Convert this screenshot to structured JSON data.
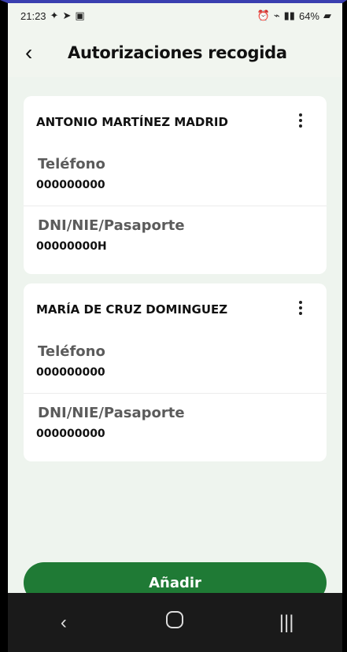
{
  "status_bar": {
    "time": "21:23",
    "battery": "64%"
  },
  "app_bar": {
    "back_icon": "‹",
    "title": "Autorizaciones recogida"
  },
  "authorizations": [
    {
      "name": "ANTONIO MARTÍNEZ MADRID",
      "phone_label": "Teléfono",
      "phone_value": "000000000",
      "id_label": "DNI/NIE/Pasaporte",
      "id_value": "00000000H"
    },
    {
      "name": "MARÍA DE CRUZ DOMINGUEZ",
      "phone_label": "Teléfono",
      "phone_value": "000000000",
      "id_label": "DNI/NIE/Pasaporte",
      "id_value": "000000000"
    }
  ],
  "actions": {
    "add_label": "Añadir"
  },
  "colors": {
    "accent": "#1f7a35",
    "background": "#eef4ee"
  },
  "icons": {
    "status_left": "location-and-notification-icons",
    "status_right": "alarm-wifi-signal-battery-icons",
    "more": "kebab-menu-icon",
    "nav_back": "back-nav-icon",
    "nav_home": "home-nav-icon",
    "nav_recents": "recents-nav-icon"
  }
}
